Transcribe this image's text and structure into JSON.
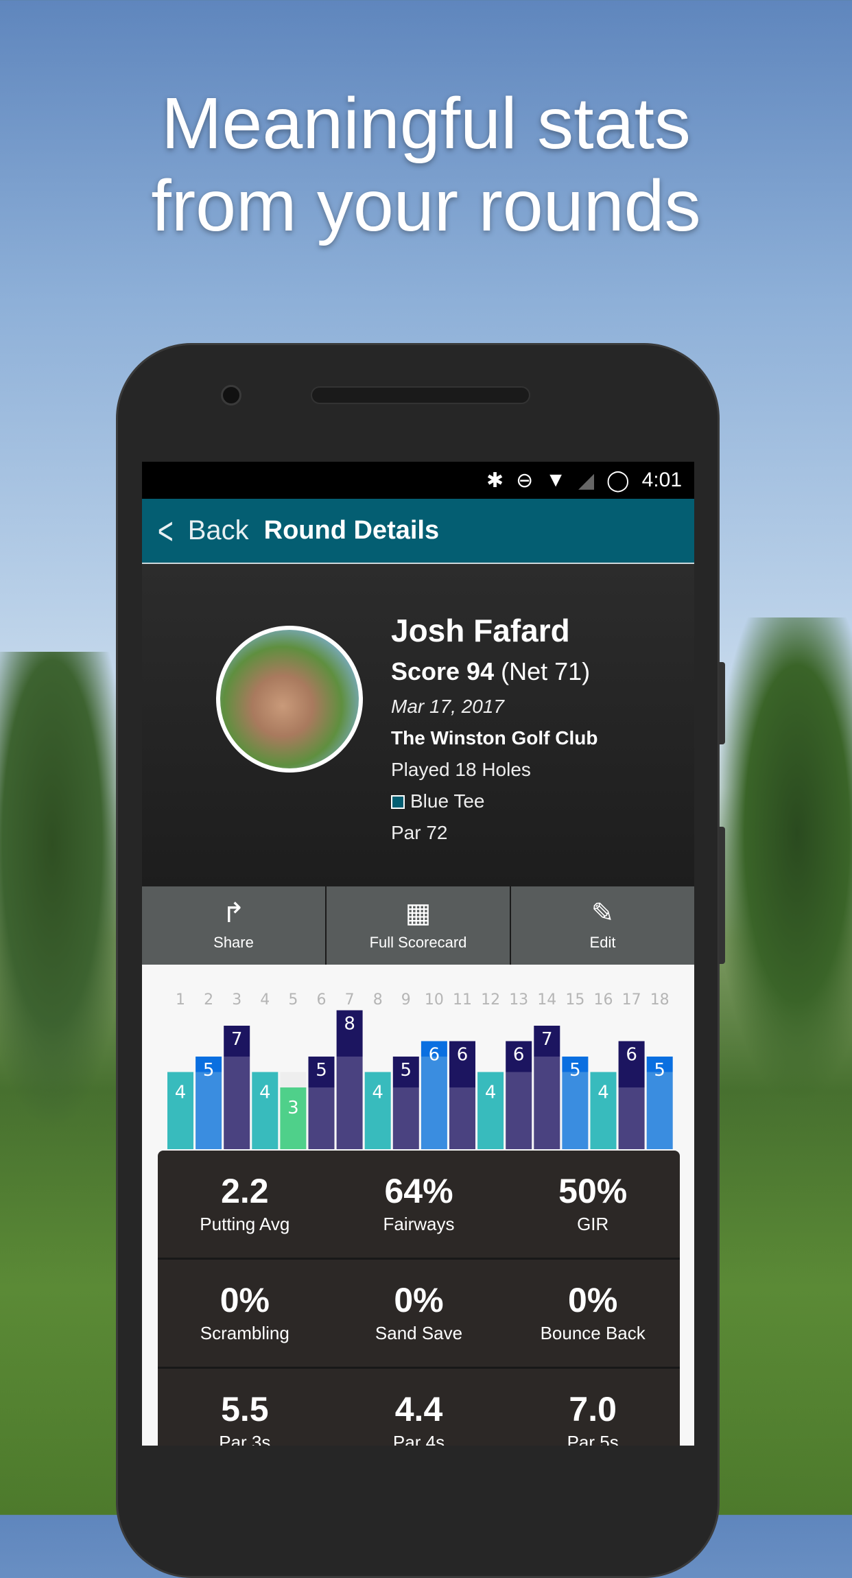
{
  "headline": {
    "line1": "Meaningful stats",
    "line2": "from your rounds"
  },
  "status_bar": {
    "time": "4:01",
    "icons": [
      "bluetooth-icon",
      "do-not-disturb-icon",
      "wifi-icon",
      "signal-icon",
      "battery-icon"
    ]
  },
  "app_bar": {
    "back_label": "Back",
    "title": "Round Details",
    "color": "#045e72"
  },
  "round": {
    "player": "Josh Fafard",
    "score_label": "Score 94",
    "net": "(Net 71)",
    "date": "Mar 17, 2017",
    "course": "The Winston Golf Club",
    "holes": "Played 18 Holes",
    "tee": "Blue Tee",
    "par": "Par 72"
  },
  "actions": [
    {
      "label": "Share",
      "icon": "share-icon"
    },
    {
      "label": "Full Scorecard",
      "icon": "grid-icon"
    },
    {
      "label": "Edit",
      "icon": "edit-icon"
    }
  ],
  "chart_data": {
    "type": "bar",
    "categories": [
      "1",
      "2",
      "3",
      "4",
      "5",
      "6",
      "7",
      "8",
      "9",
      "10",
      "11",
      "12",
      "13",
      "14",
      "15",
      "16",
      "17",
      "18"
    ],
    "series": [
      {
        "name": "Score",
        "values": [
          4,
          5,
          7,
          4,
          3,
          5,
          8,
          4,
          5,
          6,
          6,
          4,
          6,
          7,
          5,
          4,
          6,
          5
        ]
      },
      {
        "name": "Par",
        "values": [
          4,
          4,
          5,
          4,
          4,
          3,
          5,
          4,
          3,
          5,
          3,
          4,
          4,
          5,
          4,
          4,
          3,
          4
        ]
      }
    ],
    "colors": {
      "birdie": "#4fd08a",
      "par": "#38bbbd",
      "bogey_base": "#3a8de0",
      "bogey_top": "#0a6fe0",
      "double_base": "#4a4280",
      "double_top": "#1c1560"
    }
  },
  "stats": [
    [
      {
        "value": "2.2",
        "label": "Putting Avg"
      },
      {
        "value": "64%",
        "label": "Fairways"
      },
      {
        "value": "50%",
        "label": "GIR"
      }
    ],
    [
      {
        "value": "0%",
        "label": "Scrambling"
      },
      {
        "value": "0%",
        "label": "Sand Save"
      },
      {
        "value": "0%",
        "label": "Bounce Back"
      }
    ],
    [
      {
        "value": "5.5",
        "label": "Par 3s"
      },
      {
        "value": "4.4",
        "label": "Par 4s"
      },
      {
        "value": "7.0",
        "label": "Par 5s"
      }
    ]
  ]
}
